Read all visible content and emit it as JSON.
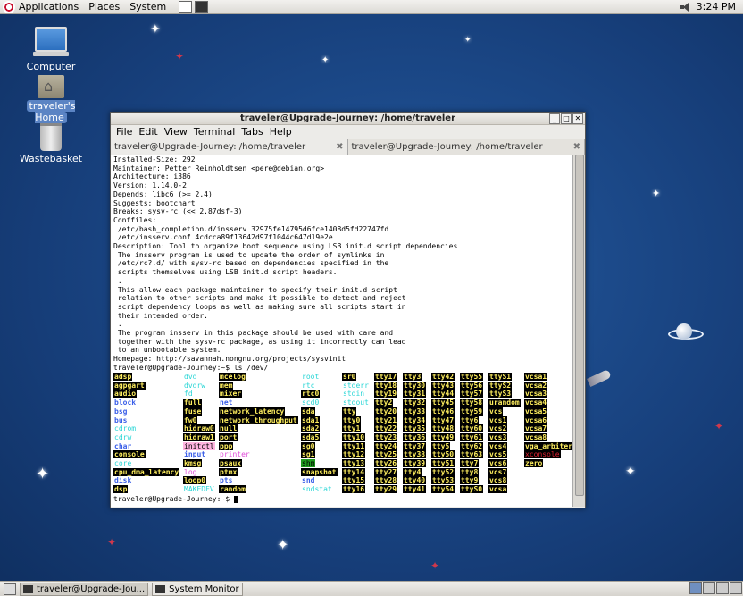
{
  "topbar": {
    "menus": [
      "Applications",
      "Places",
      "System"
    ],
    "clock": "3:24 PM"
  },
  "desktop": {
    "icons": [
      {
        "label": "Computer"
      },
      {
        "label": "traveler's Home"
      },
      {
        "label": "Wastebasket"
      }
    ]
  },
  "window": {
    "title": "traveler@Upgrade-Journey: /home/traveler",
    "menu": [
      "File",
      "Edit",
      "View",
      "Terminal",
      "Tabs",
      "Help"
    ],
    "tabs": [
      "traveler@Upgrade-Journey: /home/traveler",
      "traveler@Upgrade-Journey: /home/traveler"
    ],
    "output": "Installed-Size: 292\nMaintainer: Petter Reinholdtsen <pere@debian.org>\nArchitecture: i386\nVersion: 1.14.0-2\nDepends: libc6 (>= 2.4)\nSuggests: bootchart\nBreaks: sysv-rc (<< 2.87dsf-3)\nConffiles:\n /etc/bash_completion.d/insserv 32975fe14795d6fce1408d5fd22747fd\n /etc/insserv.conf 4cdcca89f13642d97f1044c647d19e2e\nDescription: Tool to organize boot sequence using LSB init.d script dependencies\n The insserv program is used to update the order of symlinks in\n /etc/rc?.d/ with sysv-rc based on dependencies specified in the\n scripts themselves using LSB init.d script headers.\n .\n This allow each package maintainer to specify their init.d script\n relation to other scripts and make it possible to detect and reject\n script dependency loops as well as making sure all scripts start in\n their intended order.\n .\n The program insserv in this package should be used with care and\n together with the sysv-rc package, as using it incorrectly can lead\n to an unbootable system.\nHomepage: http://savannah.nongnu.org/projects/sysvinit\ntraveler@Upgrade-Journey:~$ ls /dev/",
    "ls_columns": [
      [
        [
          "adsp",
          "tty"
        ],
        [
          "agpgart",
          "tty"
        ],
        [
          "audio",
          "tty"
        ],
        [
          "block",
          "dir"
        ],
        [
          "bsg",
          "dir"
        ],
        [
          "bus",
          "dir"
        ],
        [
          "cdrom",
          "link"
        ],
        [
          "cdrw",
          "link"
        ],
        [
          "char",
          "dir"
        ],
        [
          "console",
          "tty"
        ],
        [
          "core",
          "link"
        ],
        [
          "cpu_dma_latency",
          "tty"
        ],
        [
          "disk",
          "dir"
        ],
        [
          "dsp",
          "tty"
        ]
      ],
      [
        [
          "dvd",
          "link"
        ],
        [
          "dvdrw",
          "link"
        ],
        [
          "fd",
          "link"
        ],
        [
          "full",
          "tty"
        ],
        [
          "fuse",
          "tty"
        ],
        [
          "fw0",
          "tty"
        ],
        [
          "hidraw0",
          "tty"
        ],
        [
          "hidraw1",
          "tty"
        ],
        [
          "initctl",
          "pink"
        ],
        [
          "input",
          "dir"
        ],
        [
          "kmsg",
          "tty"
        ],
        [
          "log",
          "sock"
        ],
        [
          "loop0",
          "tty"
        ],
        [
          "MAKEDEV",
          "link"
        ]
      ],
      [
        [
          "mcelog",
          "tty"
        ],
        [
          "mem",
          "tty"
        ],
        [
          "mixer",
          "tty"
        ],
        [
          "net",
          "dir"
        ],
        [
          "network_latency",
          "tty"
        ],
        [
          "network_throughput",
          "tty"
        ],
        [
          "null",
          "tty"
        ],
        [
          "port",
          "tty"
        ],
        [
          "ppp",
          "tty"
        ],
        [
          "printer",
          "sock"
        ],
        [
          "psaux",
          "tty"
        ],
        [
          "ptmx",
          "tty"
        ],
        [
          "pts",
          "dir"
        ],
        [
          "random",
          "tty"
        ]
      ],
      [
        [
          "root",
          "link"
        ],
        [
          "rtc",
          "link"
        ],
        [
          "rtc0",
          "tty"
        ],
        [
          "scd0",
          "link"
        ],
        [
          "sda",
          "tty"
        ],
        [
          "sda1",
          "tty"
        ],
        [
          "sda2",
          "tty"
        ],
        [
          "sda5",
          "tty"
        ],
        [
          "sg0",
          "tty"
        ],
        [
          "sg1",
          "tty"
        ],
        [
          "shm",
          "green"
        ],
        [
          "snapshot",
          "tty"
        ],
        [
          "snd",
          "dir"
        ],
        [
          "sndstat",
          "link"
        ]
      ],
      [
        [
          "sr0",
          "tty"
        ],
        [
          "stderr",
          "link"
        ],
        [
          "stdin",
          "link"
        ],
        [
          "stdout",
          "link"
        ],
        [
          "tty",
          "tty"
        ],
        [
          "tty0",
          "tty"
        ],
        [
          "tty1",
          "tty"
        ],
        [
          "tty10",
          "tty"
        ],
        [
          "tty11",
          "tty"
        ],
        [
          "tty12",
          "tty"
        ],
        [
          "tty13",
          "tty"
        ],
        [
          "tty14",
          "tty"
        ],
        [
          "tty15",
          "tty"
        ],
        [
          "tty16",
          "tty"
        ]
      ],
      [
        [
          "tty17",
          "tty"
        ],
        [
          "tty18",
          "tty"
        ],
        [
          "tty19",
          "tty"
        ],
        [
          "tty2",
          "tty"
        ],
        [
          "tty20",
          "tty"
        ],
        [
          "tty21",
          "tty"
        ],
        [
          "tty22",
          "tty"
        ],
        [
          "tty23",
          "tty"
        ],
        [
          "tty24",
          "tty"
        ],
        [
          "tty25",
          "tty"
        ],
        [
          "tty26",
          "tty"
        ],
        [
          "tty27",
          "tty"
        ],
        [
          "tty28",
          "tty"
        ],
        [
          "tty29",
          "tty"
        ]
      ],
      [
        [
          "tty3",
          "tty"
        ],
        [
          "tty30",
          "tty"
        ],
        [
          "tty31",
          "tty"
        ],
        [
          "tty32",
          "tty"
        ],
        [
          "tty33",
          "tty"
        ],
        [
          "tty34",
          "tty"
        ],
        [
          "tty35",
          "tty"
        ],
        [
          "tty36",
          "tty"
        ],
        [
          "tty37",
          "tty"
        ],
        [
          "tty38",
          "tty"
        ],
        [
          "tty39",
          "tty"
        ],
        [
          "tty4",
          "tty"
        ],
        [
          "tty40",
          "tty"
        ],
        [
          "tty41",
          "tty"
        ]
      ],
      [
        [
          "tty42",
          "tty"
        ],
        [
          "tty43",
          "tty"
        ],
        [
          "tty44",
          "tty"
        ],
        [
          "tty45",
          "tty"
        ],
        [
          "tty46",
          "tty"
        ],
        [
          "tty47",
          "tty"
        ],
        [
          "tty48",
          "tty"
        ],
        [
          "tty49",
          "tty"
        ],
        [
          "tty5",
          "tty"
        ],
        [
          "tty50",
          "tty"
        ],
        [
          "tty51",
          "tty"
        ],
        [
          "tty52",
          "tty"
        ],
        [
          "tty53",
          "tty"
        ],
        [
          "tty54",
          "tty"
        ]
      ],
      [
        [
          "tty55",
          "tty"
        ],
        [
          "tty56",
          "tty"
        ],
        [
          "tty57",
          "tty"
        ],
        [
          "tty58",
          "tty"
        ],
        [
          "tty59",
          "tty"
        ],
        [
          "tty6",
          "tty"
        ],
        [
          "tty60",
          "tty"
        ],
        [
          "tty61",
          "tty"
        ],
        [
          "tty62",
          "tty"
        ],
        [
          "tty63",
          "tty"
        ],
        [
          "tty7",
          "tty"
        ],
        [
          "tty8",
          "tty"
        ],
        [
          "tty9",
          "tty"
        ],
        [
          "ttyS0",
          "tty"
        ]
      ],
      [
        [
          "ttyS1",
          "tty"
        ],
        [
          "ttyS2",
          "tty"
        ],
        [
          "ttyS3",
          "tty"
        ],
        [
          "urandom",
          "tty"
        ],
        [
          "vcs",
          "tty"
        ],
        [
          "vcs1",
          "tty"
        ],
        [
          "vcs2",
          "tty"
        ],
        [
          "vcs3",
          "tty"
        ],
        [
          "vcs4",
          "tty"
        ],
        [
          "vcs5",
          "tty"
        ],
        [
          "vcs6",
          "tty"
        ],
        [
          "vcs7",
          "tty"
        ],
        [
          "vcs8",
          "tty"
        ],
        [
          "vcsa",
          "tty"
        ]
      ],
      [
        [
          "vcsa1",
          "tty"
        ],
        [
          "vcsa2",
          "tty"
        ],
        [
          "vcsa3",
          "tty"
        ],
        [
          "vcsa4",
          "tty"
        ],
        [
          "vcsa5",
          "tty"
        ],
        [
          "vcsa6",
          "tty"
        ],
        [
          "vcsa7",
          "tty"
        ],
        [
          "vcsa8",
          "tty"
        ],
        [
          "vga_arbiter",
          "tty"
        ],
        [
          "xconsole",
          "red"
        ],
        [
          "zero",
          "tty"
        ]
      ]
    ],
    "final_prompt": "traveler@Upgrade-Journey:~$ "
  },
  "taskbar": {
    "items": [
      "traveler@Upgrade-Jou...",
      "System Monitor"
    ]
  },
  "colors": {
    "desktop_bg": "#1c4a8a",
    "tty_fg": "#ffef5f",
    "dir": "#3a5ee8",
    "link": "#2ad6d6"
  }
}
